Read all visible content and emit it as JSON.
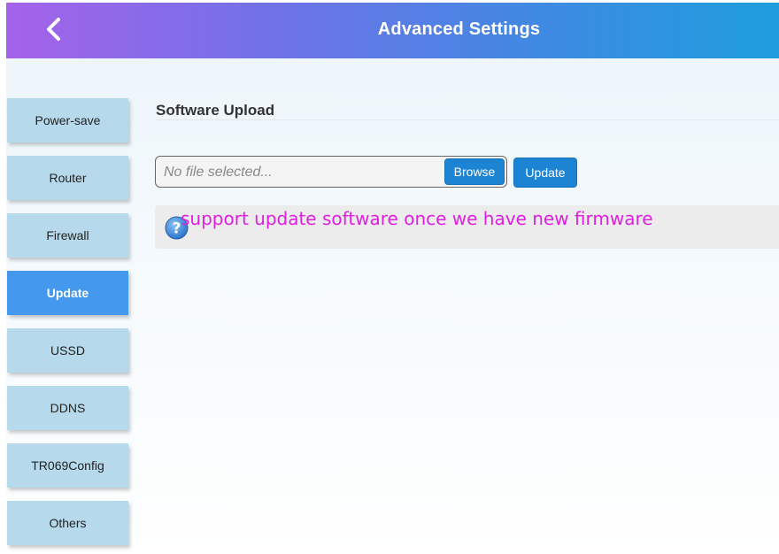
{
  "header": {
    "title": "Advanced Settings",
    "back_icon": "chevron-left-icon",
    "gradient": [
      "#a562ea",
      "#1e9ddd"
    ]
  },
  "sidebar": {
    "items": [
      {
        "label": "Power-save"
      },
      {
        "label": "Router"
      },
      {
        "label": "Firewall"
      },
      {
        "label": "Update",
        "active": true
      },
      {
        "label": "USSD"
      },
      {
        "label": "DDNS"
      },
      {
        "label": "TR069Config"
      },
      {
        "label": "Others"
      }
    ],
    "colors": {
      "item": "#b6d9ec",
      "active": "#4499ee"
    }
  },
  "main": {
    "section_title": "Software Upload",
    "file_input": {
      "placeholder": "No file selected...",
      "browse_label": "Browse"
    },
    "update_label": "Update",
    "info": {
      "icon": "question-circle-icon",
      "text": "support update software once we have new firmware",
      "text_color": "#e020e0"
    }
  }
}
